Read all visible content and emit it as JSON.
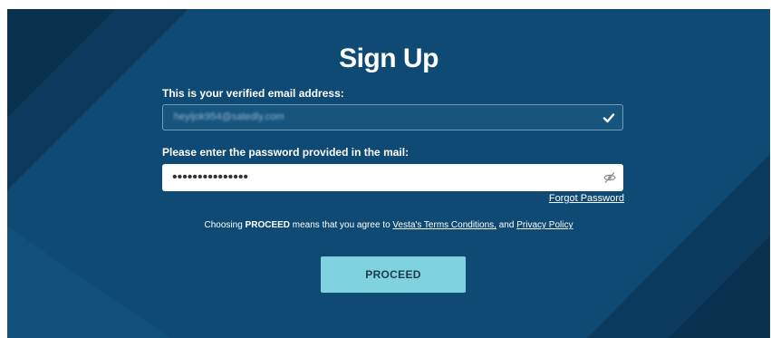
{
  "page": {
    "title": "Sign Up"
  },
  "form": {
    "email_label": "This is your verified email address:",
    "email_value": "heyijok954@satedly.com",
    "password_label": "Please enter the password provided in the mail:",
    "password_value": "•••••••••••••••",
    "forgot_password": "Forgot Password"
  },
  "terms": {
    "prefix": "Choosing ",
    "bold_word": "PROCEED",
    "middle": " means that you agree to ",
    "terms_link": "Vesta's Terms Conditions,",
    "and_text": " and ",
    "privacy_link": "Privacy Policy"
  },
  "actions": {
    "proceed_label": "PROCEED"
  },
  "icons": {
    "email_status": "checkmark-icon",
    "password_toggle": "eye-slash-icon"
  },
  "colors": {
    "background": "#0e4a73",
    "button": "#7fd3de",
    "button_text": "#1f3a4d"
  }
}
